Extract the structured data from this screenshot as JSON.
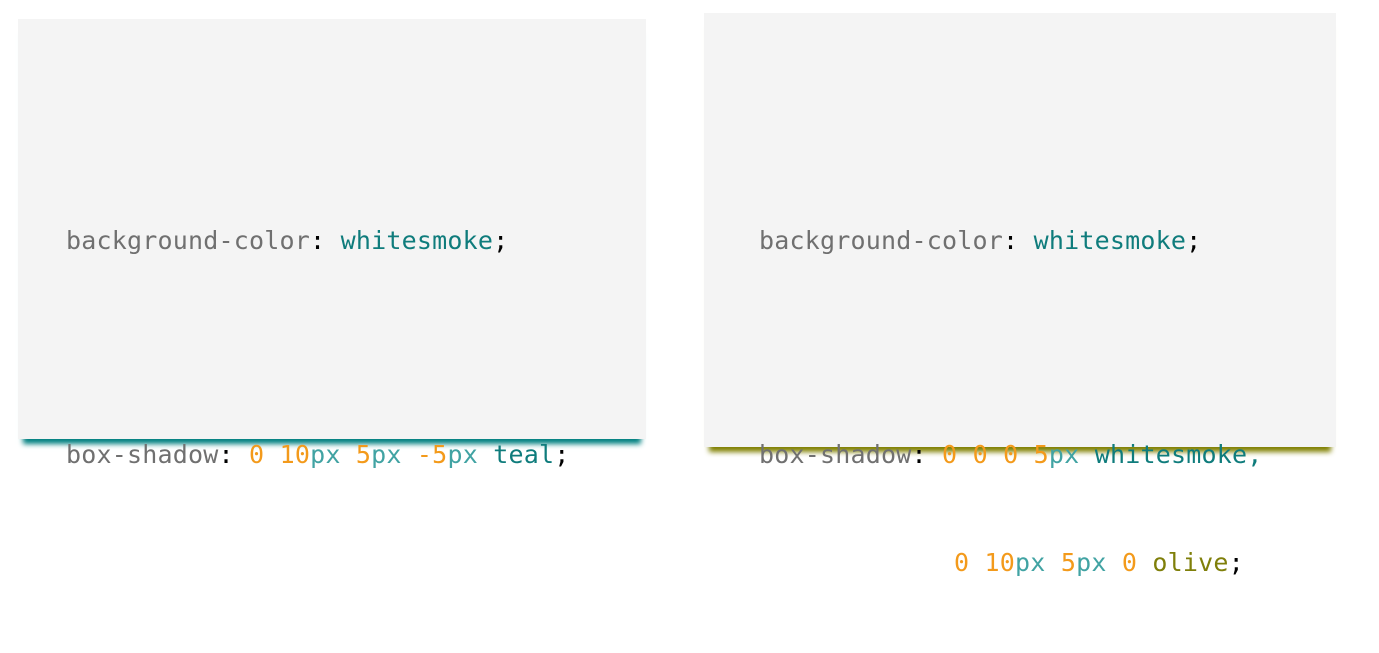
{
  "colors": {
    "card_background": "#f4f4f4",
    "teal_shadow": "#008080",
    "olive_shadow": "#808000",
    "property": "#707070",
    "number": "#f39a1b",
    "unit": "#41a3a3",
    "keyword_teal": "#0f7c7c",
    "keyword_olive": "#7f7f0a"
  },
  "card1": {
    "bg_prop": "background-color",
    "colon": ":",
    "bg_value": "whitesmoke",
    "semicolon": ";",
    "shadow_prop": "box-shadow",
    "shadow": {
      "n1": "0",
      "n2": "10",
      "u2": "px",
      "n3": "5",
      "u3": "px",
      "n4": "-5",
      "u4": "px",
      "color": "teal"
    }
  },
  "card2": {
    "bg_prop": "background-color",
    "colon": ":",
    "bg_value": "whitesmoke",
    "semicolon": ";",
    "shadow_prop": "box-shadow",
    "shadow_a": {
      "n1": "0",
      "n2": "0",
      "n3": "0",
      "n4": "5",
      "u4": "px",
      "color": "whitesmoke",
      "comma": ","
    },
    "shadow_b": {
      "n1": "0",
      "n2": "10",
      "u2": "px",
      "n3": "5",
      "u3": "px",
      "n4": "0",
      "color": "olive"
    }
  }
}
